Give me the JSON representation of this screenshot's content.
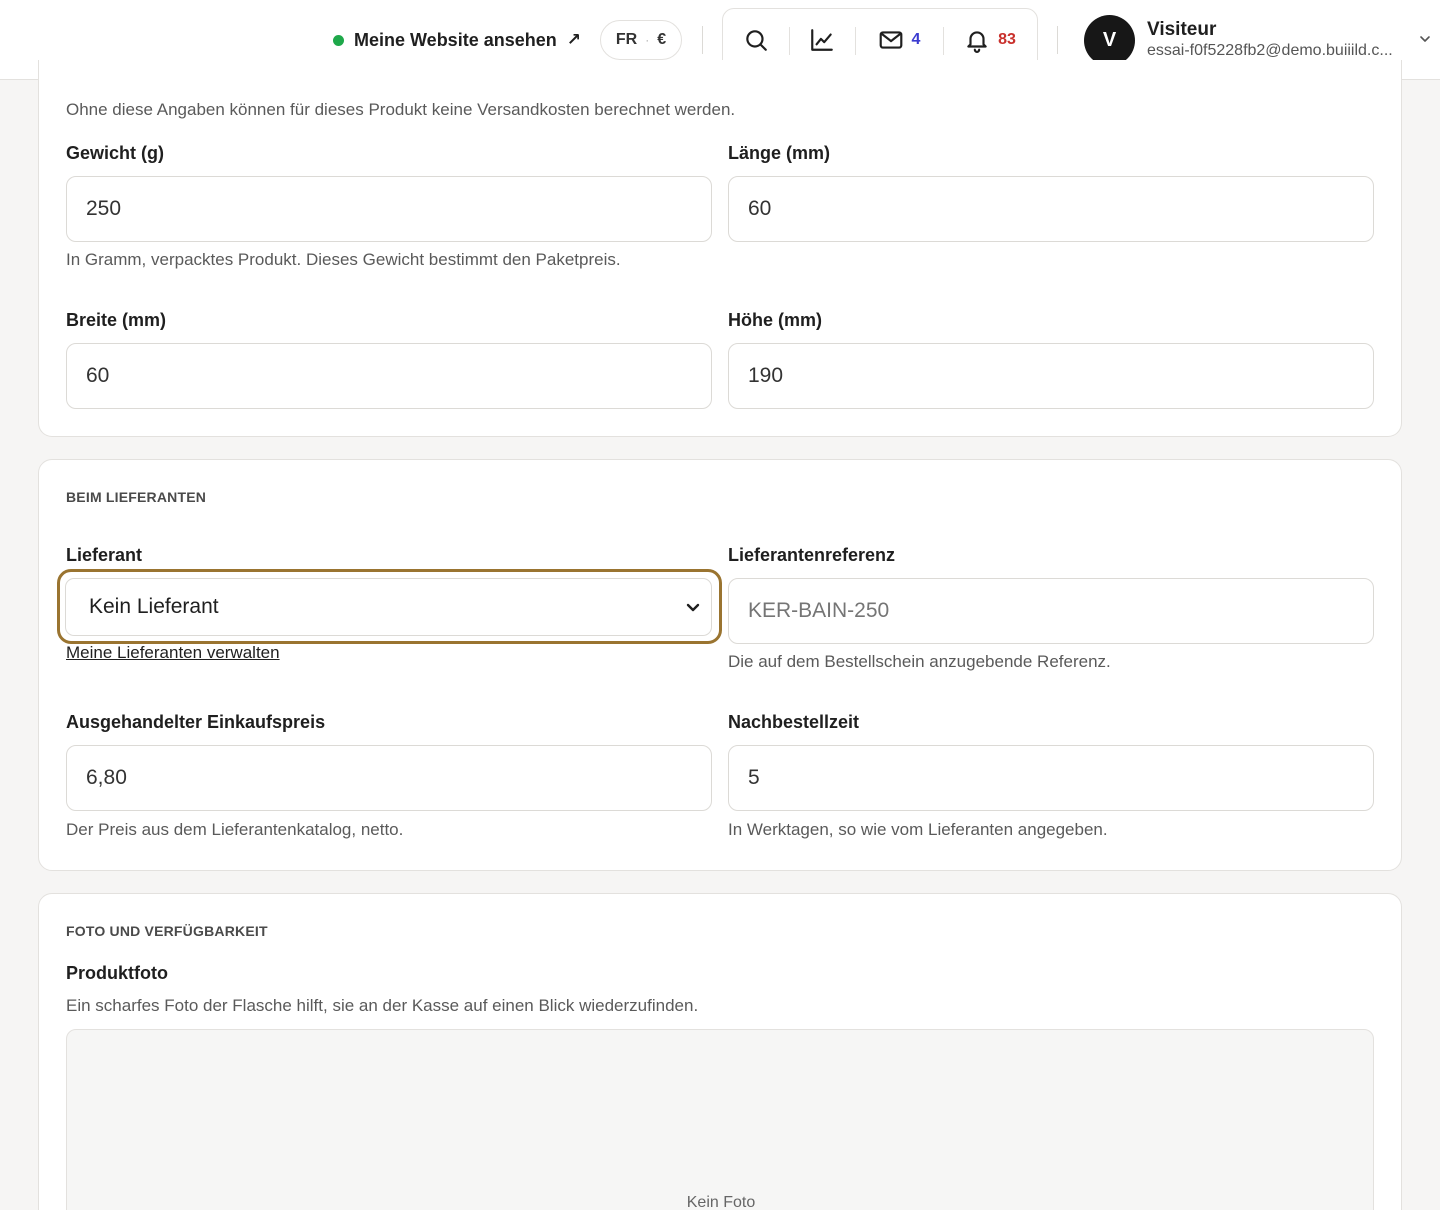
{
  "header": {
    "site_link": "Meine Website ansehen",
    "site_link_arrow": "↗",
    "locale_lang": "FR",
    "locale_sep": "·",
    "locale_currency": "€",
    "messages_count": "4",
    "notifications_count": "83",
    "user": {
      "initial": "V",
      "name": "Visiteur",
      "email": "essai-f0f5228fb2@demo.buiiild.c..."
    },
    "colors": {
      "status_dot": "#1ea84a",
      "messages_count": "#3b3bd0",
      "notifications_count": "#c9302c"
    }
  },
  "shipping": {
    "intro": "Ohne diese Angaben können für dieses Produkt keine Versandkosten berechnet werden.",
    "weight_label": "Gewicht (g)",
    "weight_value": "250",
    "weight_help": "In Gramm, verpacktes Produkt. Dieses Gewicht bestimmt den Paketpreis.",
    "length_label": "Länge (mm)",
    "length_value": "60",
    "width_label": "Breite (mm)",
    "width_value": "60",
    "height_label": "Höhe (mm)",
    "height_value": "190"
  },
  "supplier": {
    "section_title": "BEIM LIEFERANTEN",
    "supplier_label": "Lieferant",
    "supplier_selected": "Kein Lieferant",
    "manage_link": "Meine Lieferanten verwalten",
    "reference_label": "Lieferantenreferenz",
    "reference_placeholder": "KER-BAIN-250",
    "reference_help": "Die auf dem Bestellschein anzugebende Referenz.",
    "price_label": "Ausgehandelter Einkaufspreis",
    "price_value": "6,80",
    "price_help": "Der Preis aus dem Lieferantenkatalog, netto.",
    "lead_label": "Nachbestellzeit",
    "lead_value": "5",
    "lead_help": "In Werktagen, so wie vom Lieferanten angegeben.",
    "focus_color": "#9a7430"
  },
  "photo": {
    "section_title": "FOTO UND VERFÜGBARKEIT",
    "photo_label": "Produktfoto",
    "photo_help": "Ein scharfes Foto der Flasche hilft, sie an der Kasse auf einen Blick wiederzufinden.",
    "empty_text": "Kein Foto"
  }
}
